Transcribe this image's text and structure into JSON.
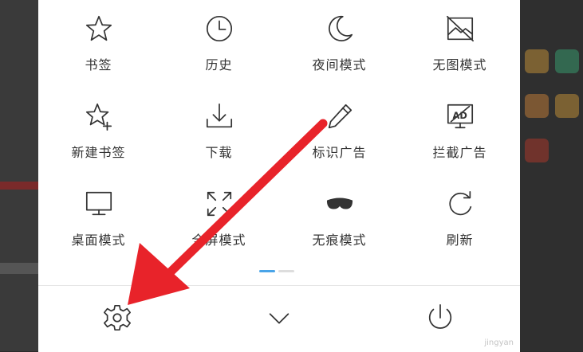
{
  "menu": {
    "items": [
      {
        "label": "书签",
        "icon": "star-icon"
      },
      {
        "label": "历史",
        "icon": "clock-icon"
      },
      {
        "label": "夜间模式",
        "icon": "moon-icon"
      },
      {
        "label": "无图模式",
        "icon": "no-image-icon"
      },
      {
        "label": "新建书签",
        "icon": "star-plus-icon"
      },
      {
        "label": "下载",
        "icon": "download-icon"
      },
      {
        "label": "标识广告",
        "icon": "pencil-icon"
      },
      {
        "label": "拦截广告",
        "icon": "ad-block-icon"
      },
      {
        "label": "桌面模式",
        "icon": "monitor-icon"
      },
      {
        "label": "全屏模式",
        "icon": "fullscreen-icon"
      },
      {
        "label": "无痕模式",
        "icon": "mask-icon"
      },
      {
        "label": "刷新",
        "icon": "refresh-icon"
      }
    ]
  },
  "pager": {
    "pages": 2,
    "current": 1
  },
  "bottom_bar": {
    "settings": "gear-icon",
    "collapse": "chevron-down-icon",
    "exit": "power-icon"
  },
  "watermark": "jingyan",
  "colors": {
    "accent": "#49a4e8",
    "arrow": "#e8232a",
    "icon": "#333333"
  }
}
